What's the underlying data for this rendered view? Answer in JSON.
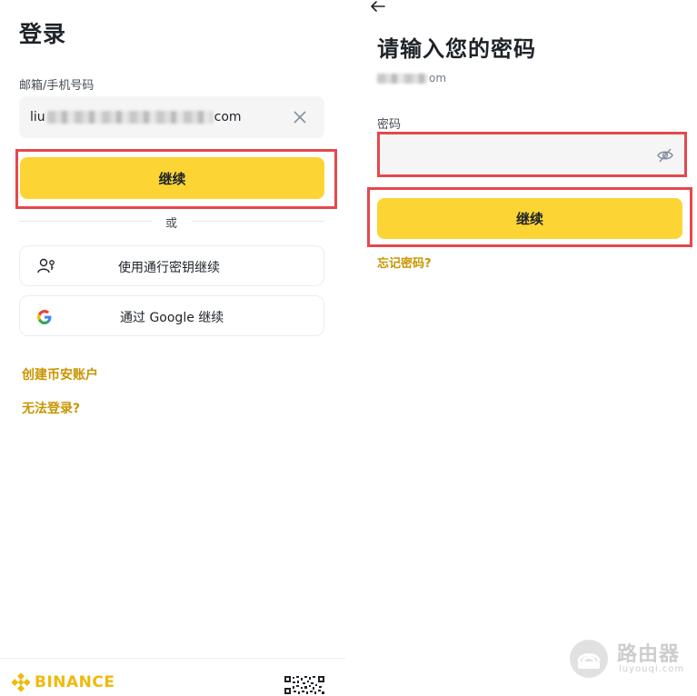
{
  "login": {
    "title": "登录",
    "field_label": "邮箱/手机号码",
    "email_prefix": "liu",
    "email_suffix": "com",
    "continue_label": "继续",
    "or_label": "或",
    "passkey_label": "使用通行密钥继续",
    "google_label": "通过 Google 继续",
    "create_account_label": "创建币安账户",
    "cant_login_label": "无法登录?",
    "brand_name": "BINANCE"
  },
  "password": {
    "title": "请输入您的密码",
    "masked_email_suffix": "om",
    "field_label": "密码",
    "password_value": "",
    "continue_label": "继续",
    "forgot_label": "忘记密码?"
  },
  "watermark": {
    "name": "路由器",
    "url": "luyouqi.com"
  },
  "colors": {
    "brand_yellow": "#fcd535",
    "brand_gold": "#f0b90b",
    "link": "#c99400",
    "highlight_red": "#e5484d"
  },
  "icons": {
    "back": "arrow-left-icon",
    "clear": "close-icon",
    "eye": "eye-slash-icon",
    "passkey": "passkey-person-icon",
    "google": "google-logo-icon",
    "qr": "qr-code-icon",
    "brand": "binance-logo-icon"
  }
}
